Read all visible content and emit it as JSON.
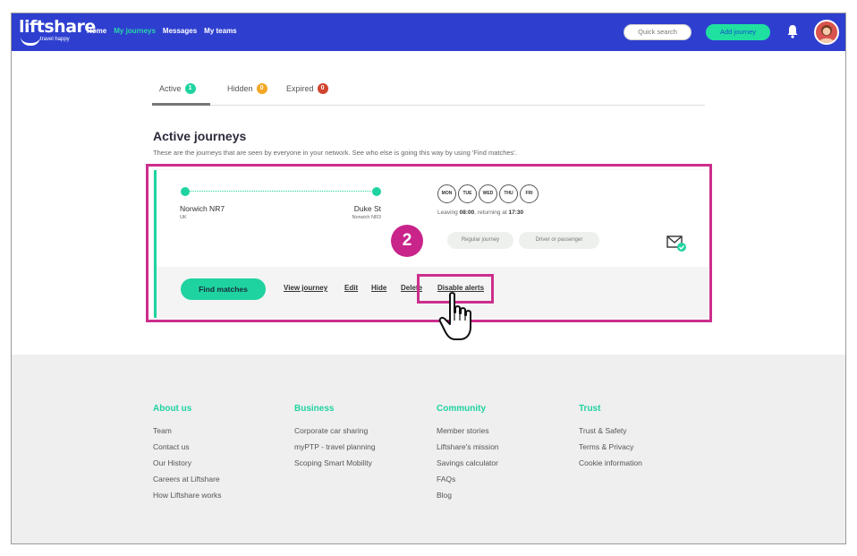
{
  "brand": {
    "name": "liftshare",
    "tagline": "travel happy"
  },
  "nav": {
    "links": [
      {
        "label": "Home",
        "active": false
      },
      {
        "label": "My journeys",
        "active": true
      },
      {
        "label": "Messages",
        "active": false
      },
      {
        "label": "My teams",
        "active": false
      }
    ],
    "quick_search_label": "Quick search",
    "add_journey_label": "Add journey"
  },
  "tabs": [
    {
      "label": "Active",
      "count": "1",
      "color": "#1fd3a0"
    },
    {
      "label": "Hidden",
      "count": "0",
      "color": "#f5a623"
    },
    {
      "label": "Expired",
      "count": "0",
      "color": "#d0452f"
    }
  ],
  "section": {
    "title": "Active journeys",
    "subtitle": "These are the journeys that are seen by everyone in your network. See who else is going this way by using 'Find matches'."
  },
  "journey": {
    "origin": "Norwich NR7",
    "origin_sub": "UK",
    "destination": "Duke St",
    "destination_sub": "Norwich NR3",
    "days": [
      "MON",
      "TUE",
      "WED",
      "THU",
      "FRI"
    ],
    "leaving_prefix": "Leaving",
    "leaving_time": "08:00",
    "returning_prefix": ", returning at",
    "returning_time": "17:30",
    "chips": [
      "Regular journey",
      "Driver or passenger"
    ],
    "find_matches_label": "Find matches",
    "actions": [
      "View journey",
      "Edit",
      "Hide",
      "Delete",
      "Disable alerts"
    ]
  },
  "step_number": "2",
  "footer": {
    "columns": [
      {
        "heading": "About us",
        "links": [
          "Team",
          "Contact us",
          "Our History",
          "Careers at Liftshare",
          "How Liftshare works"
        ]
      },
      {
        "heading": "Business",
        "links": [
          "Corporate car sharing",
          "myPTP - travel planning",
          "Scoping Smart Mobility"
        ]
      },
      {
        "heading": "Community",
        "links": [
          "Member stories",
          "Liftshare's mission",
          "Savings calculator",
          "FAQs",
          "Blog"
        ]
      },
      {
        "heading": "Trust",
        "links": [
          "Trust & Safety",
          "Terms & Privacy",
          "Cookie information"
        ]
      }
    ]
  },
  "colors": {
    "brand": "#2e3fd0",
    "accent": "#1fd3a0",
    "highlight": "#cc2e8c"
  }
}
